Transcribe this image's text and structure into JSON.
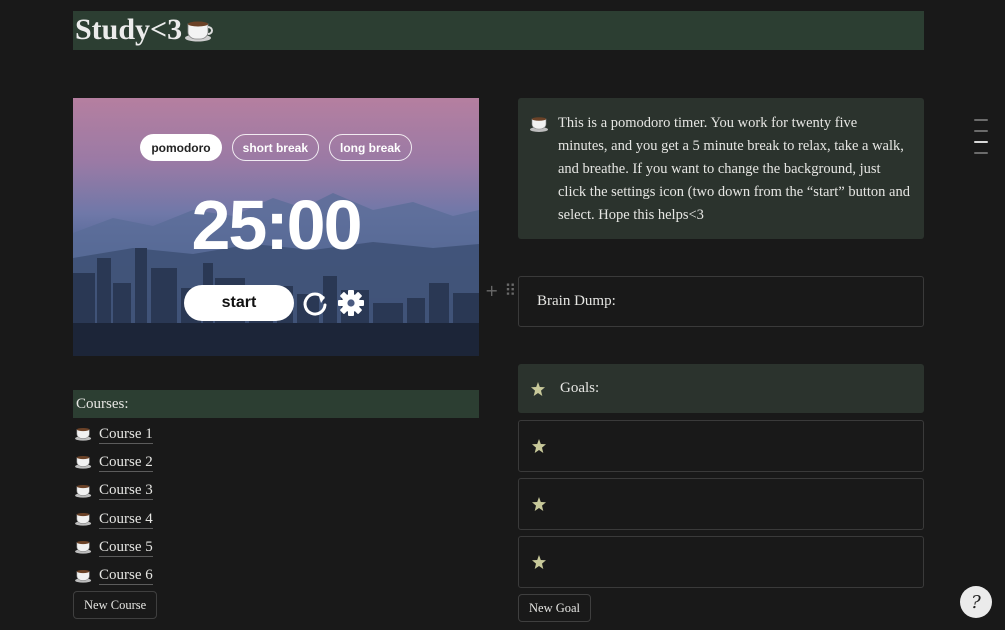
{
  "page": {
    "title": "Study<3"
  },
  "timer": {
    "modes": [
      "pomodoro",
      "short break",
      "long break"
    ],
    "active_mode": "pomodoro",
    "time": "25:00",
    "start_label": "start"
  },
  "callout": {
    "text": "This is a pomodoro timer. You work for twenty five minutes, and you get a 5 minute break to relax, take a walk, and breathe. If you want to change the background, just click the settings icon (two down from the “start” button and select. Hope this helps<3"
  },
  "brain_dump": {
    "label": "Brain Dump:"
  },
  "goals": {
    "label": "Goals:",
    "items": [
      "",
      "",
      ""
    ],
    "new_label": "New Goal"
  },
  "courses": {
    "label": "Courses:",
    "items": [
      "Course 1",
      "Course 2",
      "Course 3",
      "Course 4",
      "Course 5",
      "Course 6"
    ],
    "new_label": "New Course"
  },
  "colors": {
    "background": "#191919",
    "header_green": "#2c3e32",
    "callout_bg": "#2b332d",
    "star": "#c8c99a"
  },
  "icons": {
    "title": "coffee-cup-icon",
    "course": "coffee-cup-icon",
    "goal": "star-icon",
    "reset": "reset-icon",
    "settings": "gear-icon",
    "help": "help-icon"
  }
}
